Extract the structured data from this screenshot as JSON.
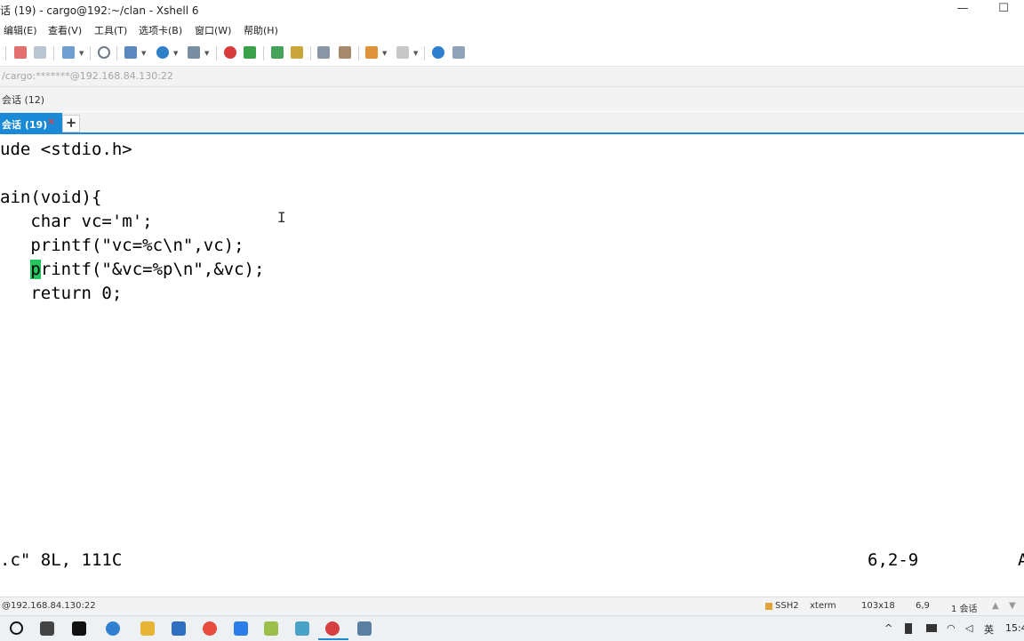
{
  "window": {
    "title": "话 (19) - cargo@192:~/clan - Xshell 6",
    "min_symbol": "—",
    "max_symbol": "☐"
  },
  "menu": [
    "编辑(E)",
    "查看(V)",
    "工具(T)",
    "选项卡(B)",
    "窗口(W)",
    "帮助(H)"
  ],
  "address": "/cargo:*******@192.168.84.130:22",
  "session_label": "会话 (12)",
  "tabs": {
    "active_label": "会话 (19)",
    "close_symbol": "×",
    "add_symbol": "+"
  },
  "terminal": {
    "lines": [
      "ude <stdio.h>",
      "",
      "ain(void){",
      "   char vc='m';",
      "   printf(\"vc=%c\\n\",vc);",
      "   printf(\"&vc=%p\\n\",&vc);",
      "   return 0;"
    ],
    "cursor_line": {
      "indent": "   ",
      "cursor_char": "p",
      "rest": "rintf(\"&vc=%p\\n\",&vc);"
    },
    "status_left": ".c\" 8L, 111C",
    "status_pos": "6,2-9",
    "status_right": "A"
  },
  "statusbar": {
    "connection": "@192.168.84.130:22",
    "protocol": "SSH2",
    "term": "xterm",
    "size": "103x18",
    "cursor": "6,9",
    "sessions": "1 会话"
  },
  "taskbar": {
    "lang": "英",
    "time": "15:4"
  },
  "colors": {
    "accent": "#1a89d6",
    "cursor": "#22c55e"
  }
}
